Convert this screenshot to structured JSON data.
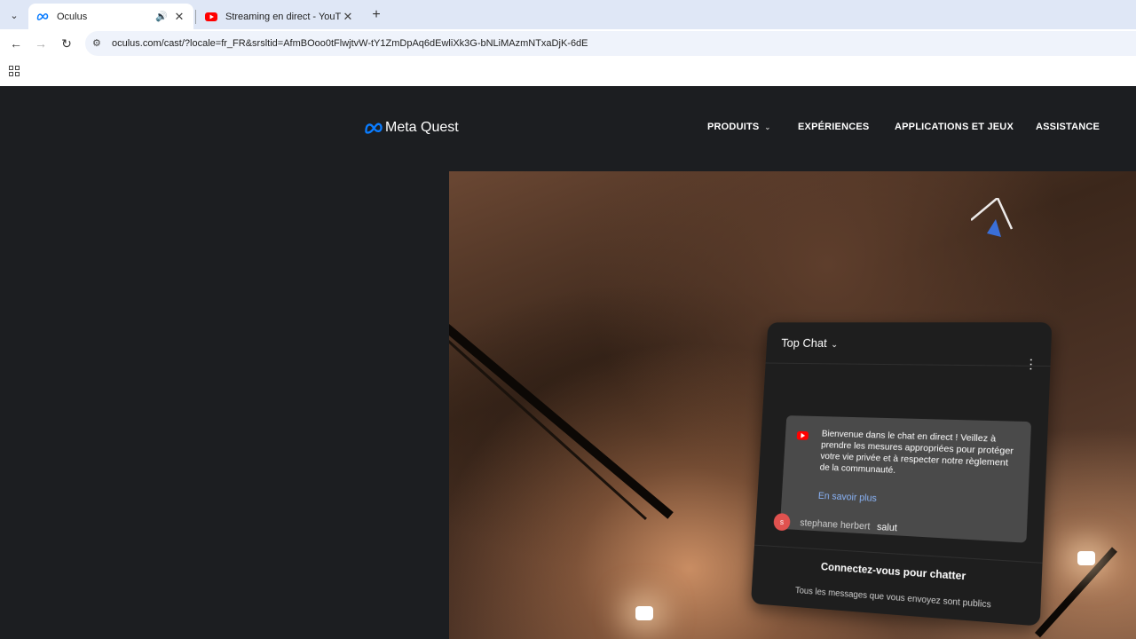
{
  "browser": {
    "tabs": [
      {
        "title": "Oculus",
        "active": true,
        "icon": "meta-icon"
      },
      {
        "title": "Streaming en direct - YouTube",
        "active": false,
        "icon": "youtube-icon"
      }
    ],
    "url": "oculus.com/cast/?locale=fr_FR&srsltid=AfmBOoo0tFlwjtvW-tY1ZmDpAq6dEwliXk3G-bNLiMAzmNTxaDjK-6dE"
  },
  "site": {
    "brand": "Meta Quest",
    "nav": [
      {
        "label": "PRODUITS",
        "has_dropdown": true
      },
      {
        "label": "EXPÉRIENCES"
      },
      {
        "label": "APPLICATIONS ET JEUX"
      },
      {
        "label": "ASSISTANCE"
      }
    ]
  },
  "chat": {
    "header": "Top Chat",
    "welcome_text": "Bienvenue dans le chat en direct ! Veillez à prendre les mesures appropriées pour protéger votre vie privée et à respecter notre règlement de la communauté.",
    "learn_more": "En savoir plus",
    "message": {
      "avatar_letter": "s",
      "author": "stephane herbert",
      "text": "salut"
    },
    "connect": "Connectez-vous pour chatter",
    "public_note": "Tous les messages que vous envoyez sont publics"
  },
  "colors": {
    "accent_blue": "#0a7cff",
    "youtube_red": "#ff0000",
    "link_blue": "#8ab4f8",
    "page_bg": "#1c1e21"
  }
}
